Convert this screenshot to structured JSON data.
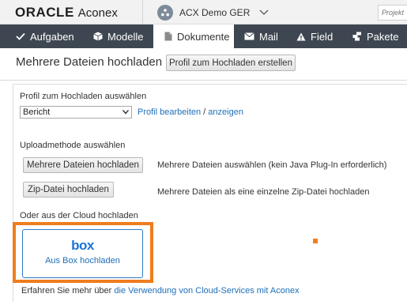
{
  "header": {
    "logo_brand": "ORACLE",
    "logo_product": "Aconex",
    "project_name": "ACX Demo GER",
    "project_search_placeholder": "Projekt"
  },
  "nav": {
    "items": [
      {
        "label": "Aufgaben",
        "icon": "check-icon"
      },
      {
        "label": "Modelle",
        "icon": "cube-icon"
      },
      {
        "label": "Dokumente",
        "icon": "document-icon",
        "active": true
      },
      {
        "label": "Mail",
        "icon": "mail-icon"
      },
      {
        "label": "Field",
        "icon": "field-icon"
      },
      {
        "label": "Pakete",
        "icon": "package-icon"
      }
    ]
  },
  "page": {
    "title": "Mehrere Dateien hochladen",
    "create_profile_button": "Profil zum Hochladen erstellen"
  },
  "profile": {
    "label": "Profil zum Hochladen auswählen",
    "selected": "Bericht",
    "edit_link": "Profil bearbeiten",
    "separator": " / ",
    "view_link": "anzeigen"
  },
  "upload": {
    "label": "Uploadmethode auswählen",
    "multi_button": "Mehrere Dateien hochladen",
    "multi_desc": "Mehrere Dateien auswählen (kein Java Plug-In erforderlich)",
    "zip_button": "Zip-Datei hochladen",
    "zip_desc": "Mehrere Dateien als eine einzelne Zip-Datei hochladen"
  },
  "cloud": {
    "label": "Oder aus der Cloud hochladen",
    "box_logo": "box",
    "box_button": "Aus Box hochladen"
  },
  "footer": {
    "prefix": "Erfahren Sie mehr über ",
    "link": "die Verwendung von Cloud-Services mit Aconex"
  },
  "colors": {
    "navbar": "#3e4751",
    "link": "#1e6fb8",
    "box_brand": "#1b73d8",
    "highlight": "#f07c1e"
  }
}
